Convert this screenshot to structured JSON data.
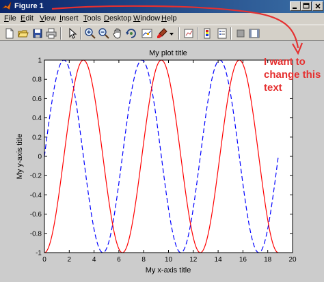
{
  "window": {
    "title": "Figure 1"
  },
  "menu": [
    {
      "label": "File",
      "underline": "F",
      "rest": "ile"
    },
    {
      "label": "Edit",
      "underline": "E",
      "rest": "dit"
    },
    {
      "label": "View",
      "underline": "V",
      "rest": "iew"
    },
    {
      "label": "Insert",
      "underline": "I",
      "rest": "nsert"
    },
    {
      "label": "Tools",
      "underline": "T",
      "rest": "ools"
    },
    {
      "label": "Desktop",
      "underline": "D",
      "rest": "esktop"
    },
    {
      "label": "Window",
      "underline": "W",
      "rest": "indow"
    },
    {
      "label": "Help",
      "underline": "H",
      "rest": "elp"
    }
  ],
  "toolbar_icons": [
    "new-figure-icon",
    "open-file-icon",
    "save-icon",
    "print-icon",
    "pointer-icon",
    "zoom-in-icon",
    "zoom-out-icon",
    "pan-icon",
    "rotate-3d-icon",
    "data-cursor-icon",
    "brush-icon",
    "dropdown-arrow-icon",
    "link-plot-icon",
    "insert-colorbar-icon",
    "insert-legend-icon",
    "hide-plot-tools-icon",
    "show-plot-tools-icon"
  ],
  "annotation": {
    "text": "I want to change this text",
    "color": "#e53030"
  },
  "chart_data": {
    "type": "line",
    "title": "My plot title",
    "xlabel": "My x-axis title",
    "ylabel": "My y-axis title",
    "xlim": [
      0,
      20
    ],
    "ylim": [
      -1,
      1
    ],
    "xticks": [
      0,
      2,
      4,
      6,
      8,
      10,
      12,
      14,
      16,
      18,
      20
    ],
    "yticks": [
      -1,
      -0.8,
      -0.6,
      -0.4,
      -0.2,
      0,
      0.2,
      0.4,
      0.6,
      0.8,
      1
    ],
    "grid": false,
    "series": [
      {
        "function": "sin(x)",
        "x_range": [
          0,
          18.85
        ],
        "color": "#0000ff",
        "style": "dashed",
        "x": [
          0,
          1.57,
          3.14,
          4.71,
          6.28,
          7.85,
          9.42,
          11.0,
          12.57,
          14.14,
          15.71,
          17.28,
          18.85
        ],
        "y": [
          0,
          1,
          0,
          -1,
          0,
          1,
          0,
          -1,
          0,
          1,
          0,
          -1,
          0
        ]
      },
      {
        "function": "-cos(x)",
        "x_range": [
          0,
          18.85
        ],
        "color": "#ff0000",
        "style": "solid",
        "x": [
          0,
          1.57,
          3.14,
          4.71,
          6.28,
          7.85,
          9.42,
          11.0,
          12.57,
          14.14,
          15.71,
          17.28,
          18.85
        ],
        "y": [
          -1,
          0,
          1,
          0,
          -1,
          0,
          1,
          0,
          -1,
          0,
          1,
          0,
          -1
        ]
      }
    ]
  }
}
